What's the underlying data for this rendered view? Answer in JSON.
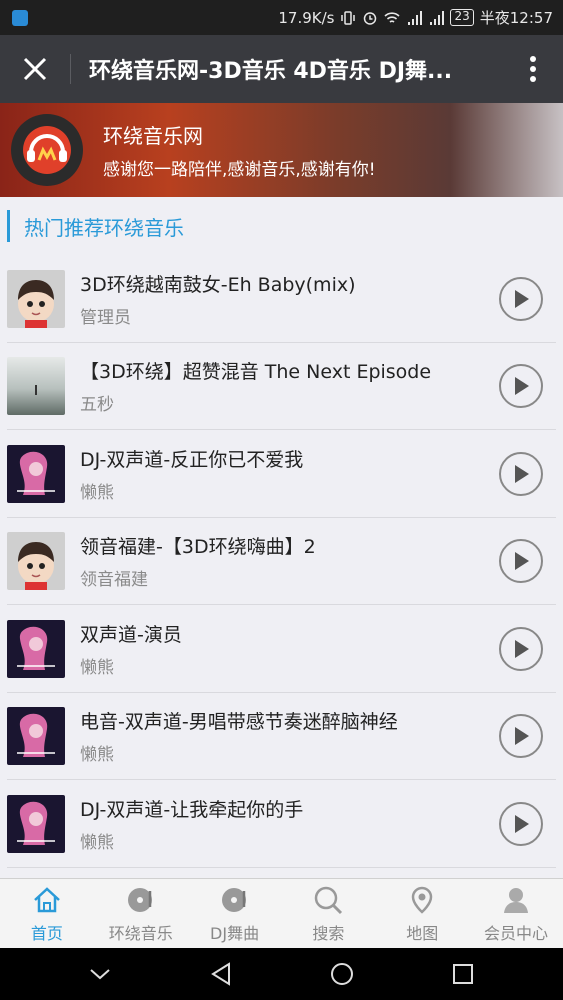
{
  "status_bar": {
    "net_speed": "17.9K/s",
    "battery": "23",
    "time": "半夜12:57",
    "icons": [
      "vibrate-icon",
      "alarm-icon",
      "wifi-icon",
      "signal-4g-icon",
      "signal-3g-icon"
    ]
  },
  "toolbar": {
    "title": "环绕音乐网-3D音乐 4D音乐 DJ舞..."
  },
  "banner": {
    "site_name": "环绕音乐网",
    "slogan": "感谢您一路陪伴,感谢音乐,感谢有你!"
  },
  "section": {
    "title": "热门推荐环绕音乐"
  },
  "songs": [
    {
      "title": "3D环绕越南鼓女-Eh Baby(mix)",
      "artist": "管理员",
      "thumb": "cartoon-boy"
    },
    {
      "title": "【3D环绕】超赞混音 The Next Episode",
      "artist": "五秒",
      "thumb": "misty-lake"
    },
    {
      "title": "DJ-双声道-反正你已不爱我",
      "artist": "懒熊",
      "thumb": "album-cover"
    },
    {
      "title": "领音福建-【3D环绕嗨曲】2",
      "artist": "领音福建",
      "thumb": "cartoon-boy"
    },
    {
      "title": "双声道-演员",
      "artist": "懒熊",
      "thumb": "album-cover"
    },
    {
      "title": "电音-双声道-男唱带感节奏迷醉脑神经",
      "artist": "懒熊",
      "thumb": "album-cover"
    },
    {
      "title": "DJ-双声道-让我牵起你的手",
      "artist": "懒熊",
      "thumb": "album-cover"
    }
  ],
  "tabs": [
    {
      "label": "首页",
      "icon": "home-icon",
      "active": true
    },
    {
      "label": "环绕音乐",
      "icon": "music-disc-icon",
      "active": false
    },
    {
      "label": "DJ舞曲",
      "icon": "dj-disc-icon",
      "active": false
    },
    {
      "label": "搜索",
      "icon": "search-icon",
      "active": false
    },
    {
      "label": "地图",
      "icon": "map-pin-icon",
      "active": false
    },
    {
      "label": "会员中心",
      "icon": "user-icon",
      "active": false
    }
  ],
  "colors": {
    "accent": "#2a9ad8",
    "toolbar": "#393a3f"
  }
}
